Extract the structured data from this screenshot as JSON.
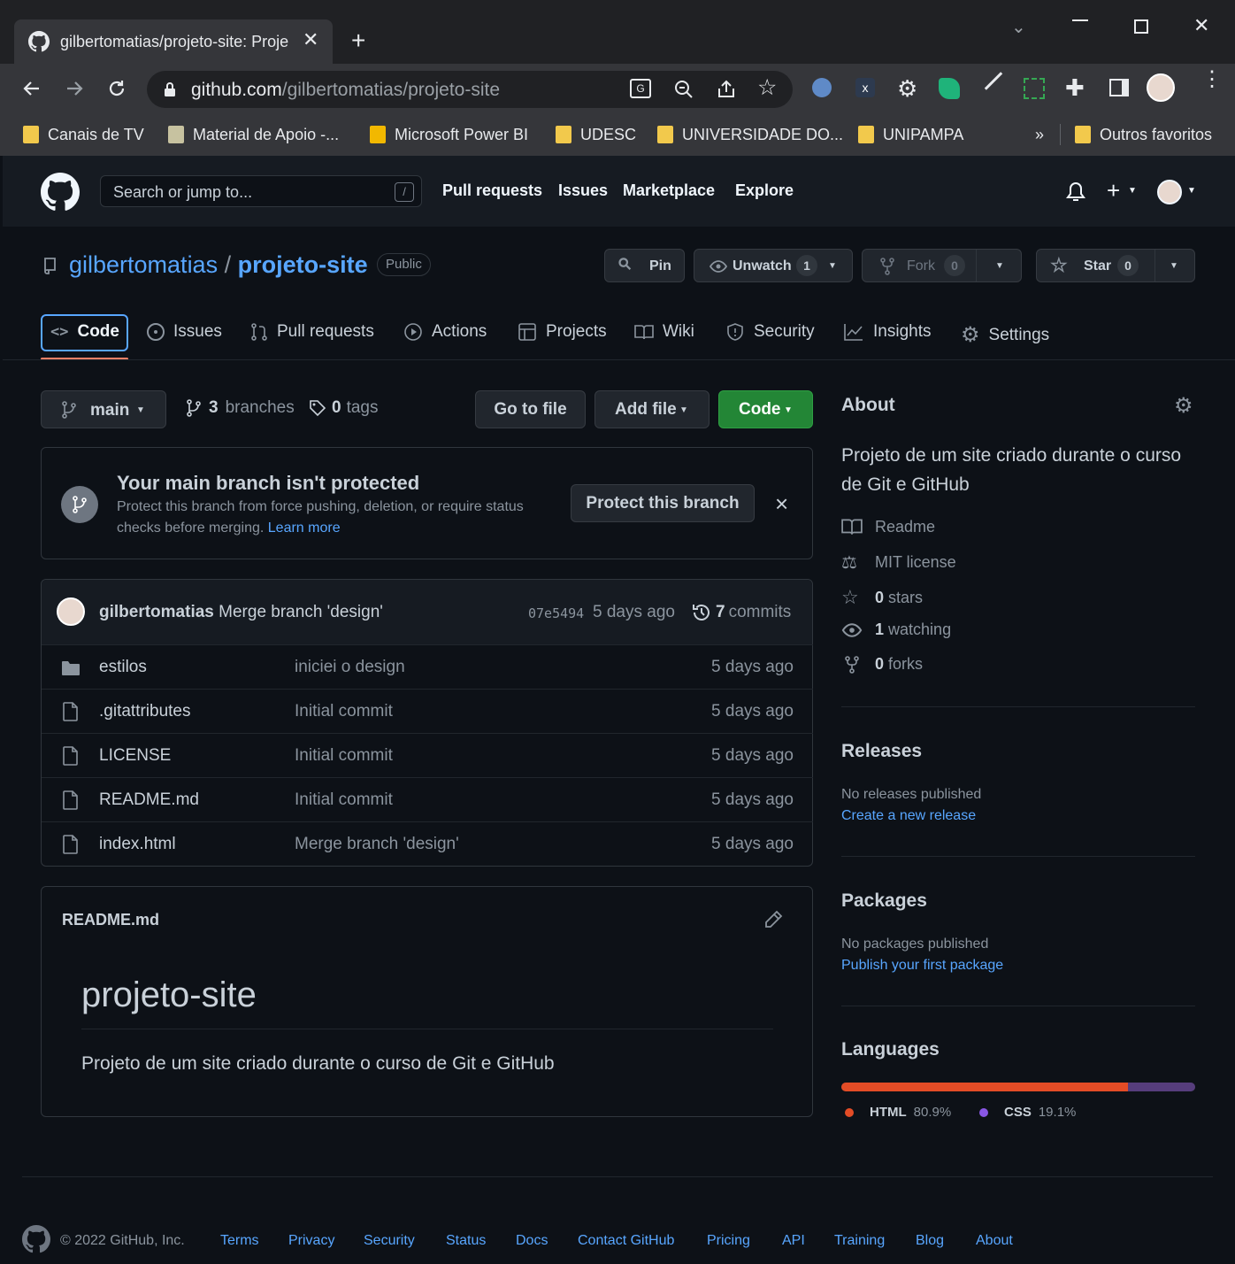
{
  "browser": {
    "tab_title": "gilbertomatias/projeto-site: Proje",
    "url_host": "github.com",
    "url_path": "/gilbertomatias/projeto-site",
    "bookmarks": [
      "Canais de TV",
      "Material de Apoio -...",
      "Microsoft Power BI",
      "UDESC",
      "UNIVERSIDADE DO...",
      "UNIPAMPA"
    ],
    "bookmarks_overflow": "»",
    "other_bookmarks": "Outros favoritos"
  },
  "header": {
    "search_placeholder": "Search or jump to...",
    "search_shortcut": "/",
    "nav": [
      "Pull requests",
      "Issues",
      "Marketplace",
      "Explore"
    ],
    "plus": "+"
  },
  "repo": {
    "owner": "gilbertomatias",
    "separator": "/",
    "name": "projeto-site",
    "visibility": "Public",
    "pin_label": "Pin",
    "unwatch_label": "Unwatch",
    "watch_count": "1",
    "fork_label": "Fork",
    "fork_count": "0",
    "star_label": "Star",
    "star_count": "0"
  },
  "tabs": [
    "Code",
    "Issues",
    "Pull requests",
    "Actions",
    "Projects",
    "Wiki",
    "Security",
    "Insights",
    "Settings"
  ],
  "branchbar": {
    "branch": "main",
    "branches_count": "3",
    "branches_label": "branches",
    "tags_count": "0",
    "tags_label": "tags",
    "go_to_file": "Go to file",
    "add_file": "Add file",
    "code": "Code"
  },
  "protect": {
    "title": "Your main branch isn't protected",
    "desc1": "Protect this branch from force pushing, deletion, or require status",
    "desc2": "checks before merging.",
    "learn_more": "Learn more",
    "button": "Protect this branch",
    "close": "×"
  },
  "commit": {
    "author": "gilbertomatias",
    "message": "Merge branch 'design'",
    "sha": "07e5494",
    "age": "5 days ago",
    "commits_count": "7",
    "commits_label": "commits"
  },
  "files": [
    {
      "name": "estilos",
      "message": "iniciei o design",
      "age": "5 days ago"
    },
    {
      "name": ".gitattributes",
      "message": "Initial commit",
      "age": "5 days ago"
    },
    {
      "name": "LICENSE",
      "message": "Initial commit",
      "age": "5 days ago"
    },
    {
      "name": "README.md",
      "message": "Initial commit",
      "age": "5 days ago"
    },
    {
      "name": "index.html",
      "message": "Merge branch 'design'",
      "age": "5 days ago"
    }
  ],
  "readme": {
    "filename": "README.md",
    "heading": "projeto-site",
    "body": "Projeto de um site criado durante o curso de Git e GitHub"
  },
  "about": {
    "title": "About",
    "desc_line1": "Projeto de um site criado durante o curso",
    "desc_line2": "de Git e GitHub",
    "readme": "Readme",
    "license": "MIT license",
    "stars_count": "0",
    "stars_label": "stars",
    "watching_count": "1",
    "watching_label": "watching",
    "forks_count": "0",
    "forks_label": "forks"
  },
  "releases": {
    "title": "Releases",
    "none": "No releases published",
    "link": "Create a new release"
  },
  "packages": {
    "title": "Packages",
    "none": "No packages published",
    "link": "Publish your first package"
  },
  "languages": {
    "title": "Languages",
    "items": [
      {
        "name": "HTML",
        "percent": "80.9%",
        "value": 80.9,
        "color": "#e34c26"
      },
      {
        "name": "CSS",
        "percent": "19.1%",
        "value": 19.1,
        "color": "#563d7c"
      }
    ]
  },
  "footer": {
    "copyright": "© 2022 GitHub, Inc.",
    "links": [
      "Terms",
      "Privacy",
      "Security",
      "Status",
      "Docs",
      "Contact GitHub",
      "Pricing",
      "API",
      "Training",
      "Blog",
      "About"
    ]
  }
}
